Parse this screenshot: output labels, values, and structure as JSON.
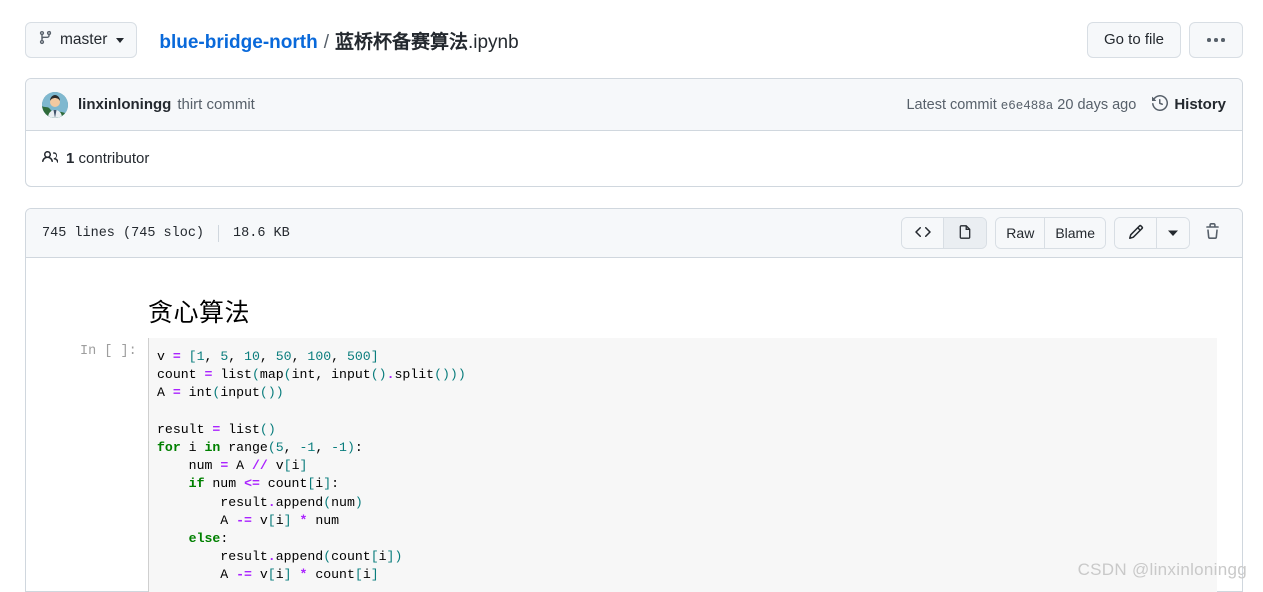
{
  "topbar": {
    "branch": {
      "label": "master",
      "icon": "git-branch-icon"
    },
    "breadcrumb": {
      "repo": "blue-bridge-north",
      "separator": "/",
      "file_name_bold": "蓝桥杯备赛算法",
      "file_name_ext": ".ipynb"
    },
    "go_to_file_label": "Go to file",
    "more_label": "···"
  },
  "commit": {
    "author": "linxinloningg",
    "message": "thirt commit",
    "latest_commit_label": "Latest commit",
    "sha": "e6e488a",
    "relative_time": "20 days ago",
    "history_label": "History",
    "contributors_count": "1",
    "contributors_label": "contributor"
  },
  "file": {
    "lines": "745 lines (745 sloc)",
    "size": "18.6 KB",
    "actions": {
      "code_view": "<>",
      "preview_view": "file-icon",
      "raw": "Raw",
      "blame": "Blame",
      "edit": "pencil-icon",
      "edit_caret": "chevron-down-icon",
      "delete": "trash-icon"
    }
  },
  "notebook": {
    "heading": "贪心算法",
    "prompt": "In [ ]:",
    "code_lines": [
      "v = [1, 5, 10, 50, 100, 500]",
      "count = list(map(int, input().split()))",
      "A = int(input())",
      "",
      "result = list()",
      "for i in range(5, -1, -1):",
      "    num = A // v[i]",
      "    if num <= count[i]:",
      "        result.append(num)",
      "        A -= v[i] * num",
      "    else:",
      "        result.append(count[i])",
      "        A -= v[i] * count[i]"
    ]
  },
  "watermark": "CSDN @linxinloningg",
  "colors": {
    "link": "#0969da",
    "border": "#d0d7de",
    "header_bg": "#f6f8fa",
    "code_bg": "#f7f7f7",
    "keyword": "#008000",
    "operator": "#aa22ff",
    "number": "#0a7d7d"
  }
}
